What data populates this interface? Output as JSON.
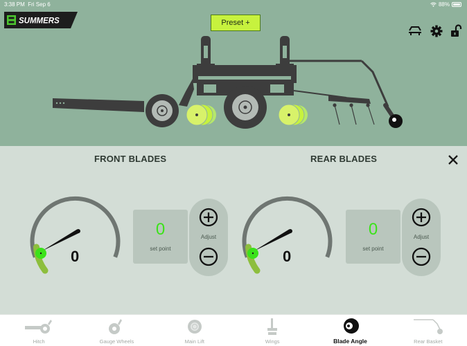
{
  "status_bar": {
    "time": "3:38 PM",
    "date": "Fri Sep 6",
    "battery": "88%"
  },
  "header": {
    "logo_text": "SUMMERS",
    "preset_label": "Preset +"
  },
  "colors": {
    "accent_green": "#c7f23e",
    "setpoint_green": "#3be21a",
    "panel_bg": "#d3ddd6",
    "hero_bg": "#8fb29c"
  },
  "icons": [
    "hitch-icon",
    "settings-gear-icon",
    "unlock-icon",
    "close-icon",
    "plus-circle-icon",
    "minus-circle-icon"
  ],
  "front": {
    "title": "FRONT BLADES",
    "gauge_value": "0",
    "set_point_value": "0",
    "set_point_label": "set point",
    "adjust_label": "Adjust"
  },
  "rear": {
    "title": "REAR BLADES",
    "gauge_value": "0",
    "set_point_value": "0",
    "set_point_label": "set point",
    "adjust_label": "Adjust"
  },
  "tabs": [
    {
      "label": "Hitch",
      "active": false
    },
    {
      "label": "Gauge Wheels",
      "active": false
    },
    {
      "label": "Main Lift",
      "active": false
    },
    {
      "label": "Wings",
      "active": false
    },
    {
      "label": "Blade Angle",
      "active": true
    },
    {
      "label": "Rear Basket",
      "active": false
    }
  ]
}
